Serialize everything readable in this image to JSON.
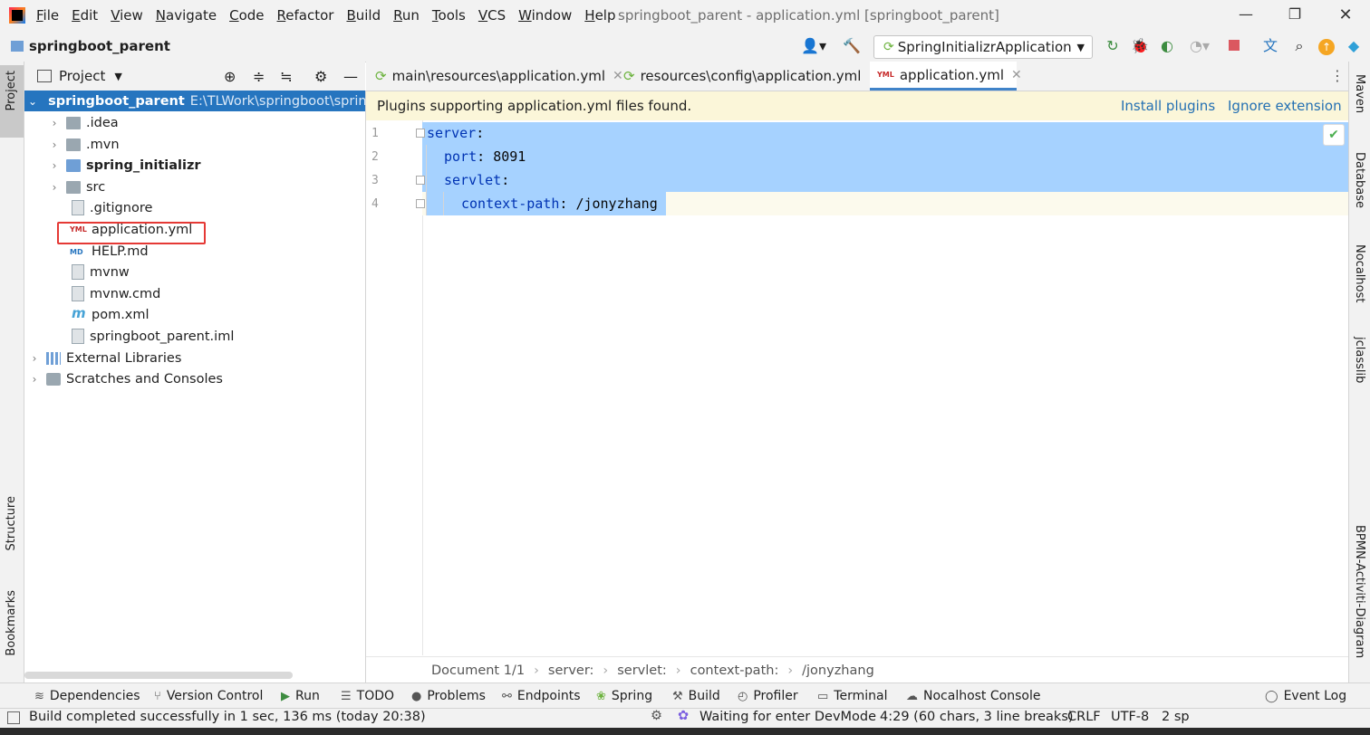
{
  "menubar": {
    "items": [
      "File",
      "Edit",
      "View",
      "Navigate",
      "Code",
      "Refactor",
      "Build",
      "Run",
      "Tools",
      "VCS",
      "Window",
      "Help"
    ],
    "window_title": "springboot_parent - application.yml [springboot_parent]"
  },
  "navbar": {
    "project_name": "springboot_parent",
    "run_config": "SpringInitializrApplication"
  },
  "left_strip": {
    "project": "Project",
    "structure": "Structure",
    "bookmarks": "Bookmarks"
  },
  "project_panel": {
    "title": "Project",
    "tree": [
      {
        "label": "springboot_parent",
        "path": "E:\\TLWork\\springboot\\sprin"
      },
      {
        "label": ".idea"
      },
      {
        "label": ".mvn"
      },
      {
        "label": "spring_initializr"
      },
      {
        "label": "src"
      },
      {
        "label": ".gitignore"
      },
      {
        "label": "application.yml"
      },
      {
        "label": "HELP.md"
      },
      {
        "label": "mvnw"
      },
      {
        "label": "mvnw.cmd"
      },
      {
        "label": "pom.xml"
      },
      {
        "label": "springboot_parent.iml"
      },
      {
        "label": "External Libraries"
      },
      {
        "label": "Scratches and Consoles"
      }
    ],
    "icon_labels": {
      "yml": "YML",
      "md": "MD",
      "maven": "m"
    }
  },
  "tabs": [
    {
      "label": "main\\resources\\application.yml"
    },
    {
      "label": "resources\\config\\application.yml"
    },
    {
      "label": "application.yml"
    }
  ],
  "banner": {
    "message": "Plugins supporting application.yml files found.",
    "install": "Install plugins",
    "ignore": "Ignore extension"
  },
  "editor": {
    "line_numbers": [
      "1",
      "2",
      "3",
      "4"
    ],
    "lines": [
      {
        "key": "server",
        "sep": ":",
        "value": ""
      },
      {
        "key": "port",
        "sep": ": ",
        "value": "8091"
      },
      {
        "key": "servlet",
        "sep": ":",
        "value": ""
      },
      {
        "key": "context-path",
        "sep": ": ",
        "value": "/jonyzhang"
      }
    ],
    "selection_color": "#a6d2ff",
    "caret_line_color": "#fcfaed"
  },
  "breadcrumb": [
    "Document 1/1",
    "server:",
    "servlet:",
    "context-path:",
    "/jonyzhang"
  ],
  "right_strip": {
    "maven": "Maven",
    "database": "Database",
    "nocalhost": "Nocalhost",
    "jclasslib": "jclasslib",
    "bpmn": "BPMN-Activiti-Diagram"
  },
  "bottom_tools": [
    "Dependencies",
    "Version Control",
    "Run",
    "TODO",
    "Problems",
    "Endpoints",
    "Spring",
    "Build",
    "Profiler",
    "Terminal",
    "Nocalhost Console",
    "Event Log"
  ],
  "status": {
    "message": "Build completed successfully in 1 sec, 136 ms (today 20:38)",
    "devmode": "Waiting for enter DevMode",
    "position": "4:29 (60 chars, 3 line breaks)",
    "line_sep": "CRLF",
    "encoding": "UTF-8",
    "indent": "2 sp"
  },
  "colors": {
    "accent_blue": "#2675bf",
    "selected_row": "#2675bf",
    "highlight_box": "#e53935",
    "banner_bg": "#fbf6d9"
  }
}
